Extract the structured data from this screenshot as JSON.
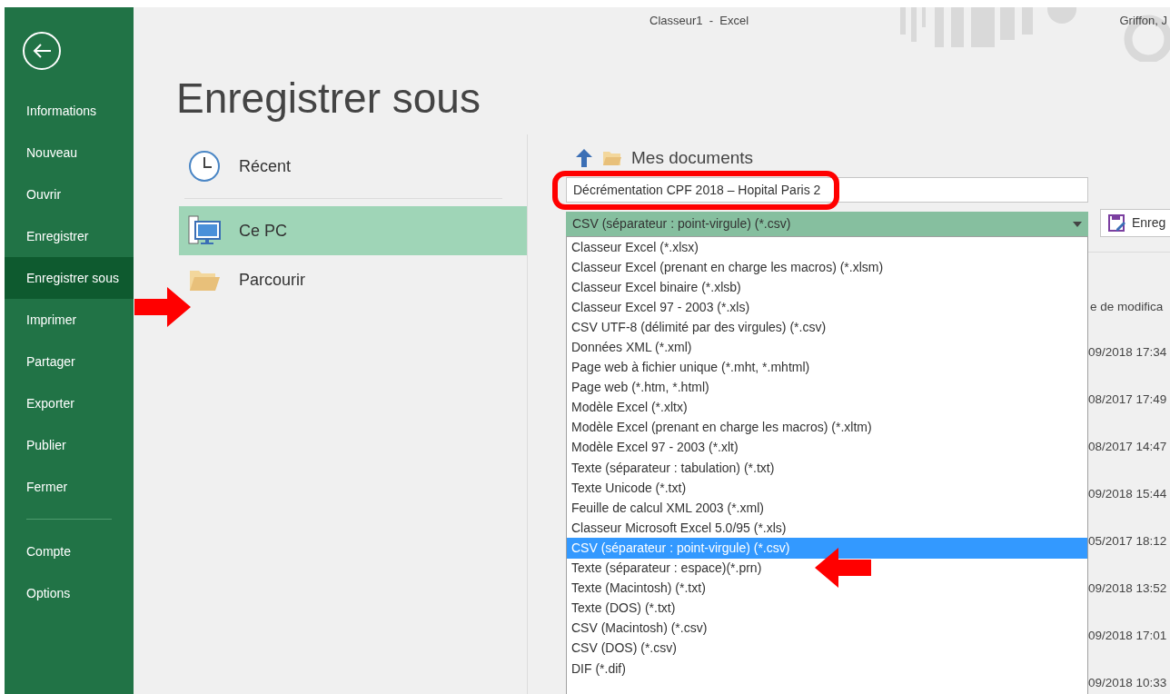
{
  "window": {
    "title": "Classeur1  -  Excel",
    "user": "Griffon, J"
  },
  "sidebar": {
    "items": [
      {
        "label": "Informations",
        "selected": false
      },
      {
        "label": "Nouveau",
        "selected": false
      },
      {
        "label": "Ouvrir",
        "selected": false
      },
      {
        "label": "Enregistrer",
        "selected": false
      },
      {
        "label": "Enregistrer sous",
        "selected": true
      },
      {
        "label": "Imprimer",
        "selected": false
      },
      {
        "label": "Partager",
        "selected": false
      },
      {
        "label": "Exporter",
        "selected": false
      },
      {
        "label": "Publier",
        "selected": false
      },
      {
        "label": "Fermer",
        "selected": false
      }
    ],
    "bottom_items": [
      {
        "label": "Compte",
        "selected": false
      },
      {
        "label": "Options",
        "selected": false
      }
    ]
  },
  "page_title": "Enregistrer sous",
  "places": [
    {
      "label": "Récent",
      "kind": "recent",
      "selected": false
    },
    {
      "label": "Ce PC",
      "kind": "pc",
      "selected": true
    },
    {
      "label": "Parcourir",
      "kind": "browse",
      "selected": false
    }
  ],
  "location": "Mes documents",
  "file_name": "Décrémentation CPF 2018 – Hopital Paris 2",
  "file_type": {
    "value": "CSV (séparateur : point-virgule) (*.csv)",
    "expanded": true,
    "options": [
      {
        "label": "Classeur Excel (*.xlsx)",
        "selected": false
      },
      {
        "label": "Classeur Excel (prenant en charge les macros) (*.xlsm)",
        "selected": false
      },
      {
        "label": "Classeur Excel binaire (*.xlsb)",
        "selected": false
      },
      {
        "label": "Classeur Excel 97 - 2003 (*.xls)",
        "selected": false
      },
      {
        "label": "CSV UTF-8 (délimité par des virgules) (*.csv)",
        "selected": false
      },
      {
        "label": "Données XML (*.xml)",
        "selected": false
      },
      {
        "label": "Page web à fichier unique (*.mht, *.mhtml)",
        "selected": false
      },
      {
        "label": "Page web (*.htm, *.html)",
        "selected": false
      },
      {
        "label": "Modèle Excel (*.xltx)",
        "selected": false
      },
      {
        "label": "Modèle Excel (prenant en charge les macros) (*.xltm)",
        "selected": false
      },
      {
        "label": "Modèle Excel 97 - 2003 (*.xlt)",
        "selected": false
      },
      {
        "label": "Texte (séparateur : tabulation) (*.txt)",
        "selected": false
      },
      {
        "label": "Texte Unicode (*.txt)",
        "selected": false
      },
      {
        "label": "Feuille de calcul XML 2003 (*.xml)",
        "selected": false
      },
      {
        "label": "Classeur Microsoft Excel 5.0/95 (*.xls)",
        "selected": false
      },
      {
        "label": "CSV (séparateur : point-virgule) (*.csv)",
        "selected": true
      },
      {
        "label": "Texte (séparateur : espace)(*.prn)",
        "selected": false
      },
      {
        "label": "Texte (Macintosh) (*.txt)",
        "selected": false
      },
      {
        "label": "Texte (DOS) (*.txt)",
        "selected": false
      },
      {
        "label": "CSV (Macintosh) (*.csv)",
        "selected": false
      },
      {
        "label": "CSV (DOS) (*.csv)",
        "selected": false
      },
      {
        "label": "DIF (*.dif)",
        "selected": false
      }
    ]
  },
  "save_button": "Enreg",
  "file_list": {
    "column_header": "e de modifica",
    "dates": [
      "09/2018 17:34",
      "08/2017 17:49",
      "08/2017 14:47",
      "09/2018 15:44",
      "05/2017 18:12",
      "09/2018 13:52",
      "09/2018 17:01",
      "09/2018 10:33"
    ]
  }
}
